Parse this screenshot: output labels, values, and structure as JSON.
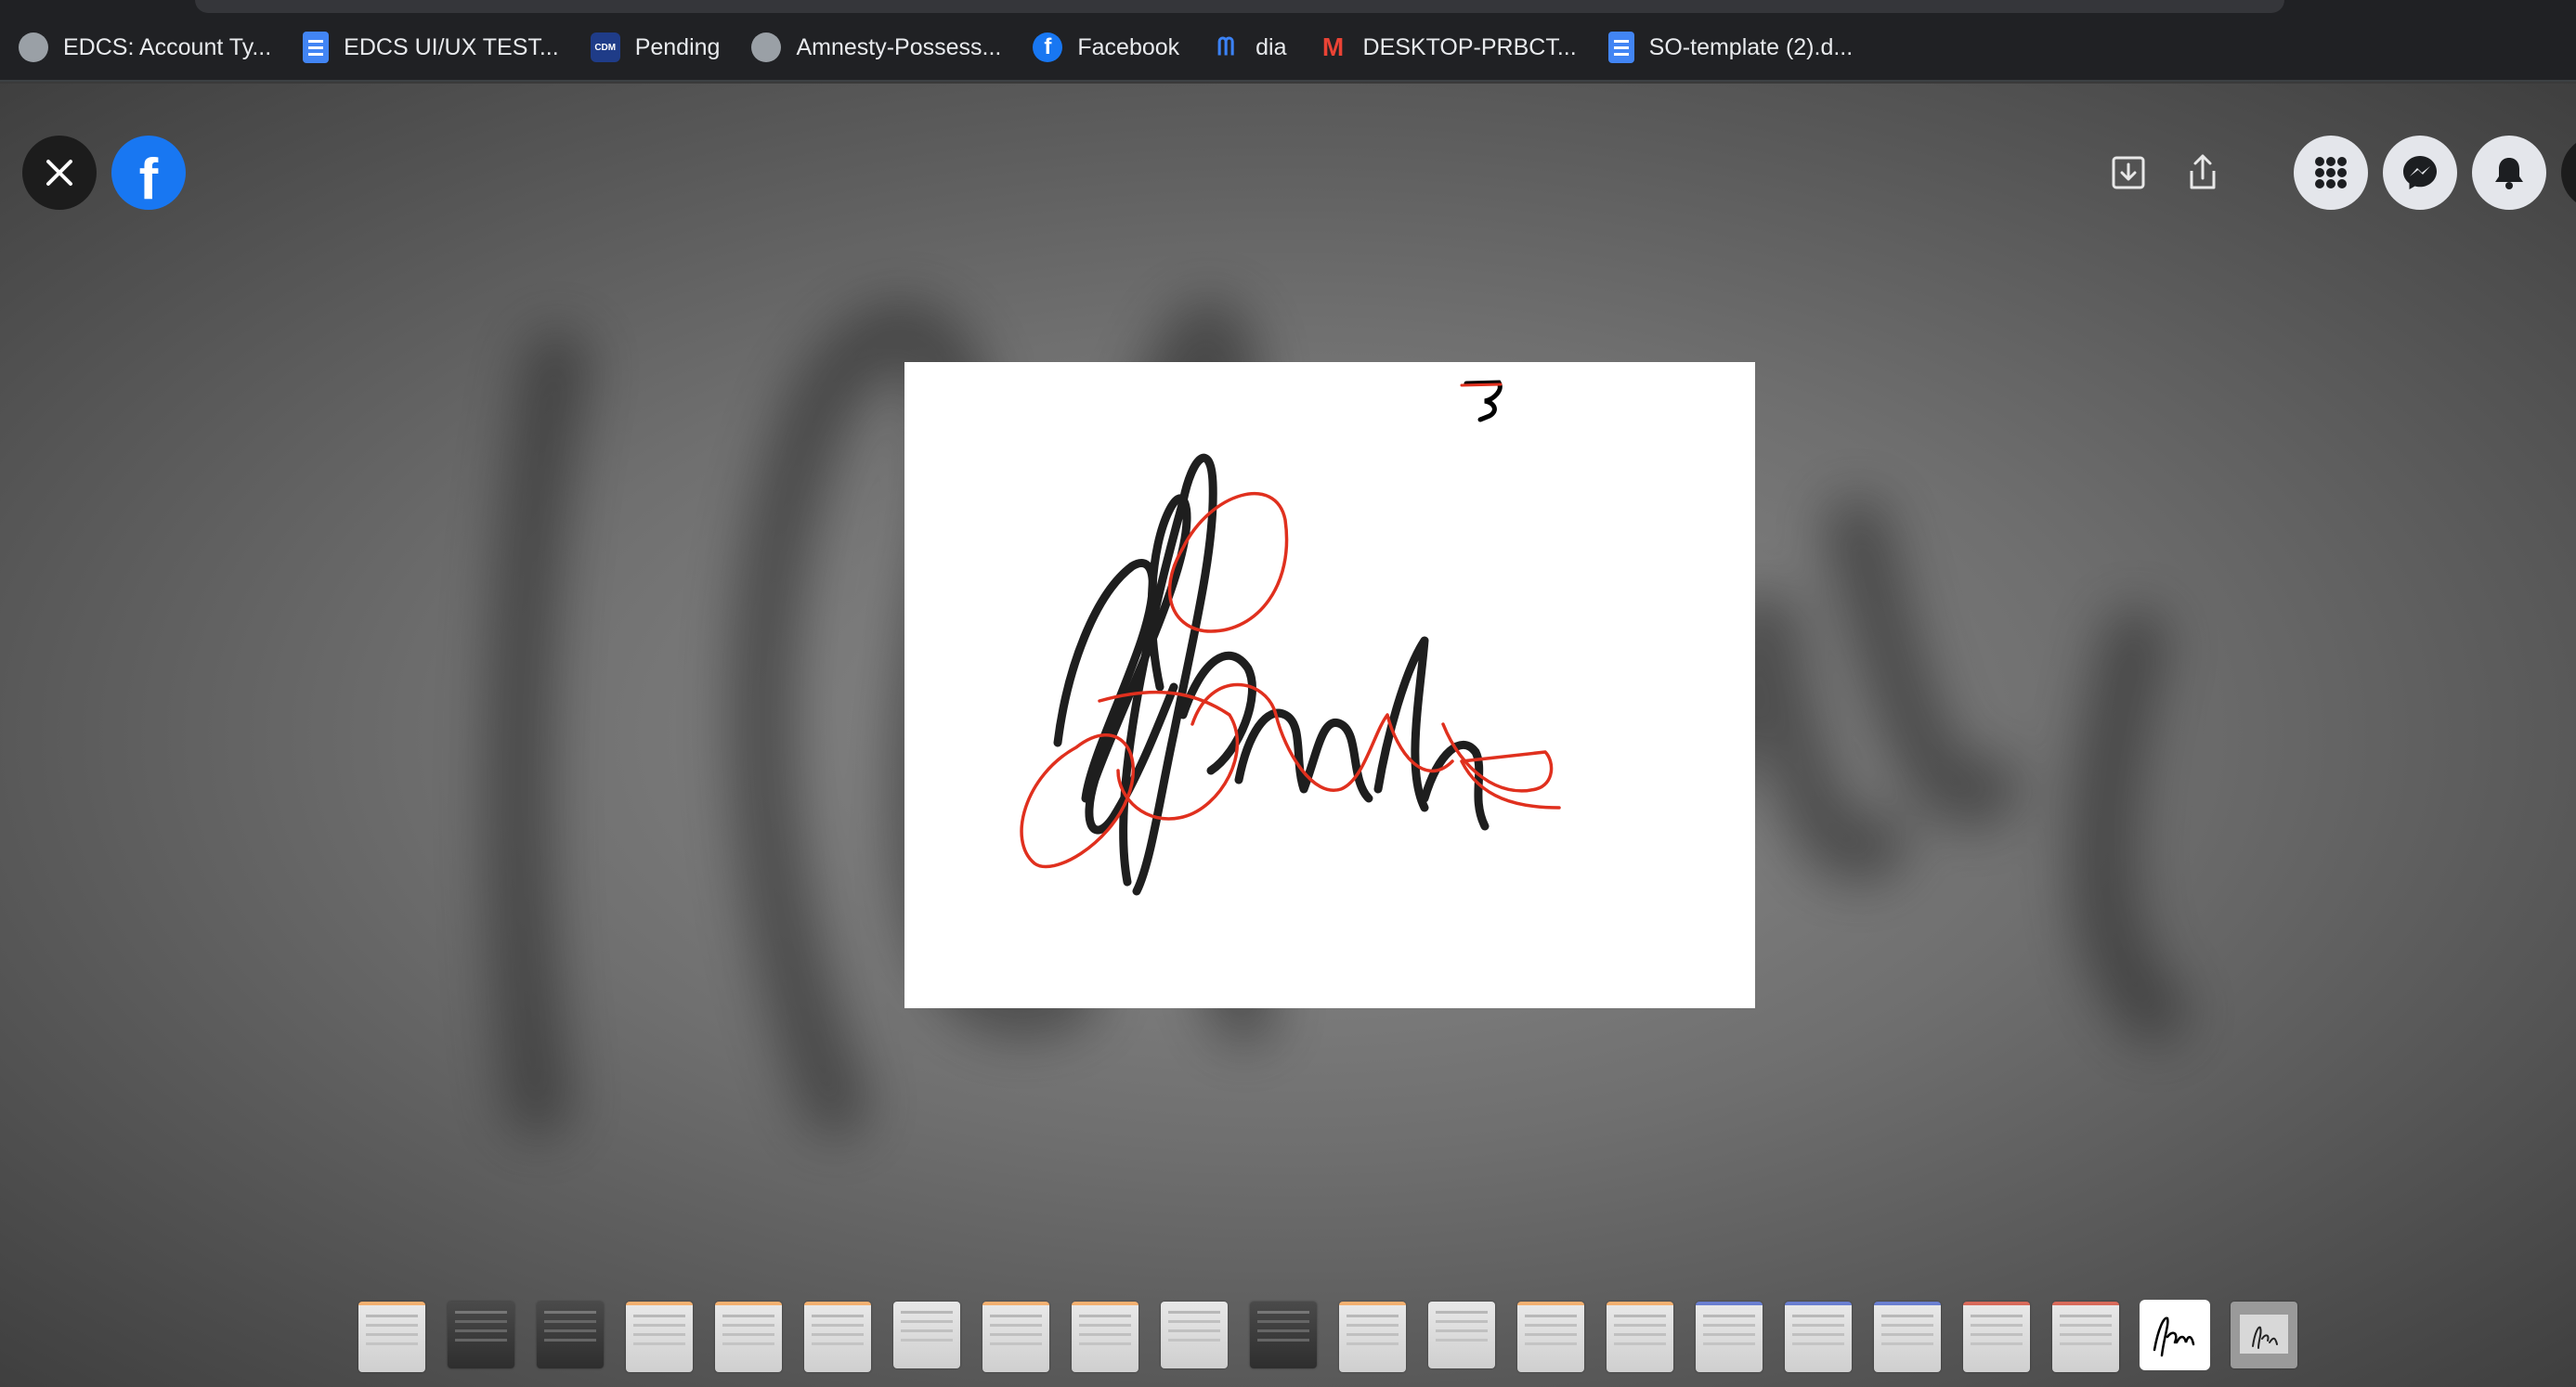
{
  "bookmarks": [
    {
      "label": "EDCS: Account Ty...",
      "icon": "globe-icon"
    },
    {
      "label": "EDCS UI/UX TEST...",
      "icon": "google-docs-icon"
    },
    {
      "label": "Pending",
      "icon": "cdm-icon"
    },
    {
      "label": "Amnesty-Possess...",
      "icon": "globe-icon"
    },
    {
      "label": "Facebook",
      "icon": "facebook-icon"
    },
    {
      "label": "dia",
      "icon": "dia-icon"
    },
    {
      "label": "DESKTOP-PRBCT...",
      "icon": "gmail-icon"
    },
    {
      "label": "SO-template (2).d...",
      "icon": "google-docs-icon"
    }
  ],
  "viewer": {
    "close_icon": "close-icon",
    "logo_glyph": "f",
    "actions": [
      "download-icon",
      "share-icon",
      "menu-grid-icon",
      "messenger-icon",
      "notifications-icon"
    ]
  },
  "photo": {
    "content": "signature-scribble-with-red-annotations",
    "ink_color": "#000000",
    "annotation_color": "#e0301e"
  },
  "thumbnails": {
    "count": 22,
    "active_index": 20
  }
}
